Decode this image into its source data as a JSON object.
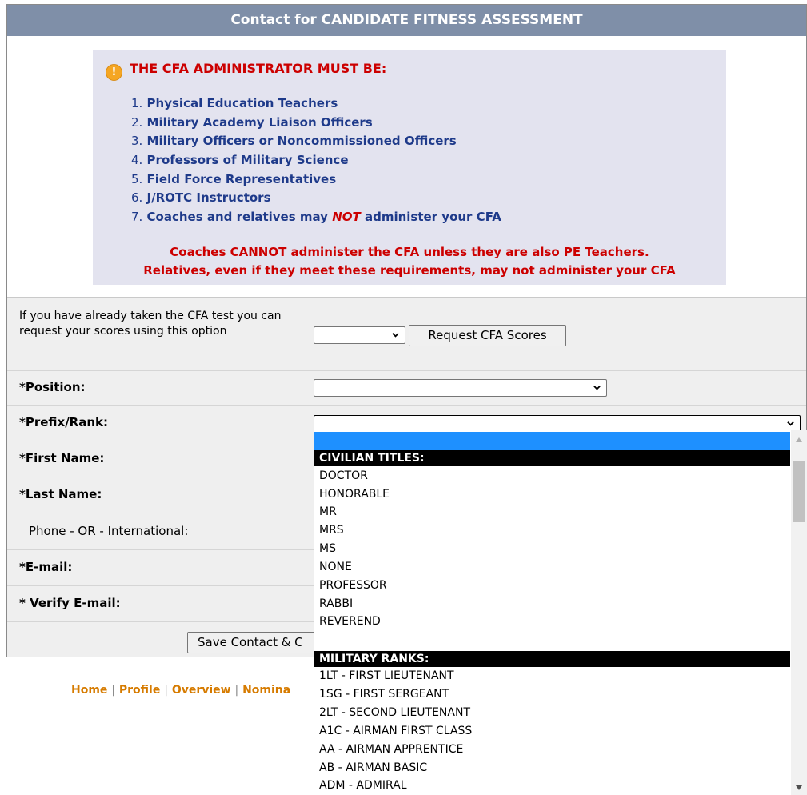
{
  "header": {
    "title": "Contact for CANDIDATE FITNESS ASSESSMENT"
  },
  "requirements": {
    "title_pre": "THE CFA ADMINISTRATOR ",
    "title_must": "MUST",
    "title_post": " BE:",
    "items": [
      {
        "num": "1.",
        "text": "Physical Education Teachers"
      },
      {
        "num": "2.",
        "text": "Military Academy Liaison Officers"
      },
      {
        "num": "3.",
        "text": "Military Officers or Noncommissioned Officers"
      },
      {
        "num": "4.",
        "text": "Professors of Military Science"
      },
      {
        "num": "5.",
        "text": "Field Force Representatives"
      },
      {
        "num": "6.",
        "text": "J/ROTC Instructors"
      }
    ],
    "item7": {
      "num": "7.",
      "pre": "Coaches and relatives may ",
      "not": "NOT",
      "post": " administer your CFA"
    },
    "note1": "Coaches CANNOT administer the CFA unless they are also PE Teachers.",
    "note2": "Relatives, even if they meet these requirements, may not administer your CFA"
  },
  "form": {
    "request_text": "If you have already taken the CFA test you can request your scores using this option",
    "request_select_value": "",
    "request_button": "Request CFA Scores",
    "position_label": "*Position:",
    "position_value": "",
    "prefix_label": "*Prefix/Rank:",
    "prefix_value": "",
    "first_name_label": "*First Name:",
    "last_name_label": "*Last Name:",
    "phone_label": "Phone - OR - International:",
    "email_label": "*E-mail:",
    "verify_email_label": "* Verify E-mail:",
    "save_button": "Save Contact & C"
  },
  "footer": {
    "links": [
      "Home",
      "Profile",
      "Overview",
      "Nomina"
    ]
  },
  "dropdown": {
    "groups": [
      {
        "label": "CIVILIAN TITLES:",
        "options": [
          "DOCTOR",
          "HONORABLE",
          "MR",
          "MRS",
          "MS",
          "NONE",
          "PROFESSOR",
          "RABBI",
          "REVEREND"
        ]
      },
      {
        "label": "MILITARY RANKS:",
        "options": [
          "1LT - FIRST LIEUTENANT",
          "1SG - FIRST SERGEANT",
          "2LT - SECOND LIEUTENANT",
          "A1C - AIRMAN FIRST CLASS",
          "AA - AIRMAN APPRENTICE",
          "AB - AIRMAN BASIC",
          "ADM - ADMIRAL"
        ]
      }
    ]
  },
  "colors": {
    "header_bg": "#7f8fa8",
    "accent_red": "#cc0000",
    "list_blue": "#1e3a8a",
    "link_orange": "#d67b00",
    "selected_option": "#1e90ff"
  }
}
